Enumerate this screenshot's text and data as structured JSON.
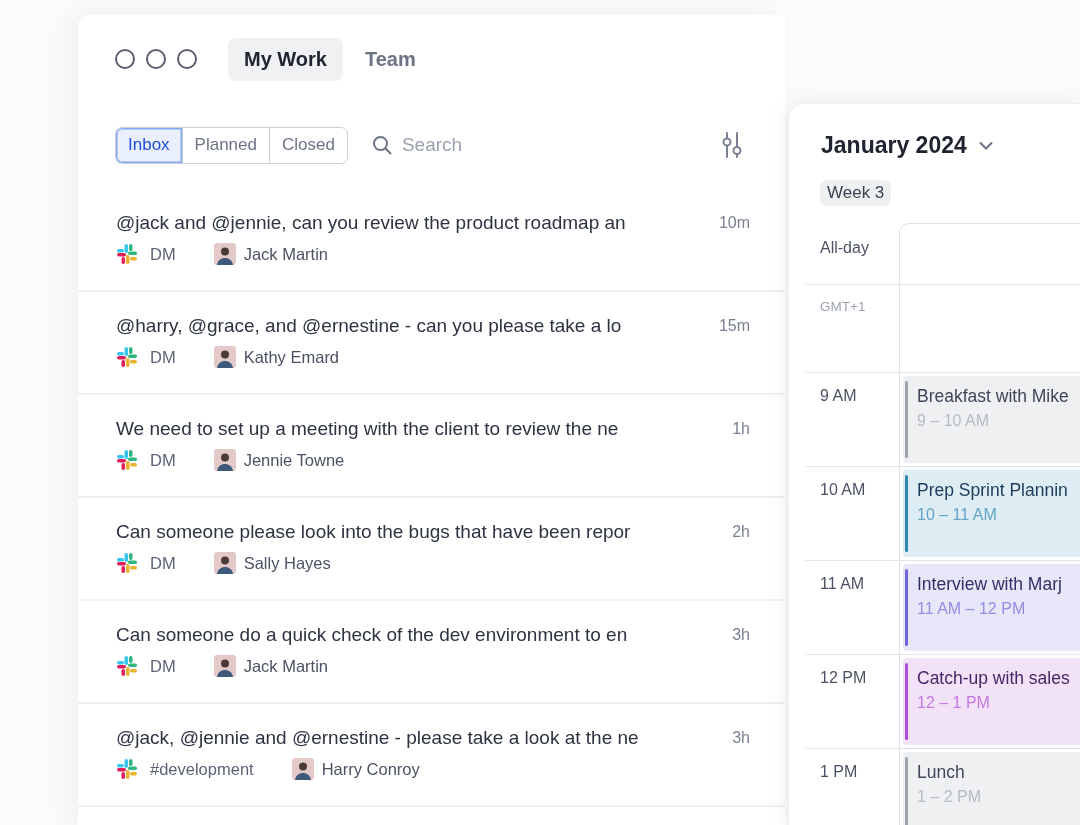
{
  "tabs": [
    {
      "label": "My Work",
      "selected": true
    },
    {
      "label": "Team",
      "selected": false
    }
  ],
  "filters": [
    {
      "label": "Inbox",
      "selected": true
    },
    {
      "label": "Planned",
      "selected": false
    },
    {
      "label": "Closed",
      "selected": false
    }
  ],
  "search": {
    "placeholder": "Search"
  },
  "messages": [
    {
      "text": "@jack and @jennie, can you review the product roadmap an",
      "time": "10m",
      "channel": "DM",
      "author": "Jack Martin"
    },
    {
      "text": "@harry, @grace, and @ernestine - can you please take a lo",
      "time": "15m",
      "channel": "DM",
      "author": "Kathy Emard"
    },
    {
      "text": "We need to set up a meeting with the client to review the ne",
      "time": "1h",
      "channel": "DM",
      "author": "Jennie Towne"
    },
    {
      "text": "Can someone please look into the bugs that have been repor",
      "time": "2h",
      "channel": "DM",
      "author": "Sally Hayes"
    },
    {
      "text": "Can someone do a quick check of the dev environment to en",
      "time": "3h",
      "channel": "DM",
      "author": "Jack Martin"
    },
    {
      "text": "@jack, @jennie and @ernestine - please take a look at the ne",
      "time": "3h",
      "channel": "#development",
      "author": "Harry Conroy"
    }
  ],
  "calendar": {
    "title": "January 2024",
    "week": "Week 3",
    "all_day_label": "All-day",
    "timezone": "GMT+1",
    "hours": [
      {
        "label": "9 AM",
        "event": {
          "title": "Breakfast with Mike",
          "time": "9 – 10 AM",
          "color": "#9ca3af"
        }
      },
      {
        "label": "10 AM",
        "event": {
          "title": "Prep Sprint Plannin",
          "time": "10 – 11 AM",
          "color": "#2f86b4"
        }
      },
      {
        "label": "11 AM",
        "event": {
          "title": "Interview with Marj",
          "time": "11 AM – 12 PM",
          "color": "#6d66dc"
        }
      },
      {
        "label": "12 PM",
        "event": {
          "title": "Catch-up with sales",
          "time": "12 – 1 PM",
          "color": "#b04bd6"
        }
      },
      {
        "label": "1 PM",
        "event": {
          "title": "Lunch",
          "time": "1 – 2 PM",
          "color": "#9ca3af"
        }
      }
    ]
  }
}
